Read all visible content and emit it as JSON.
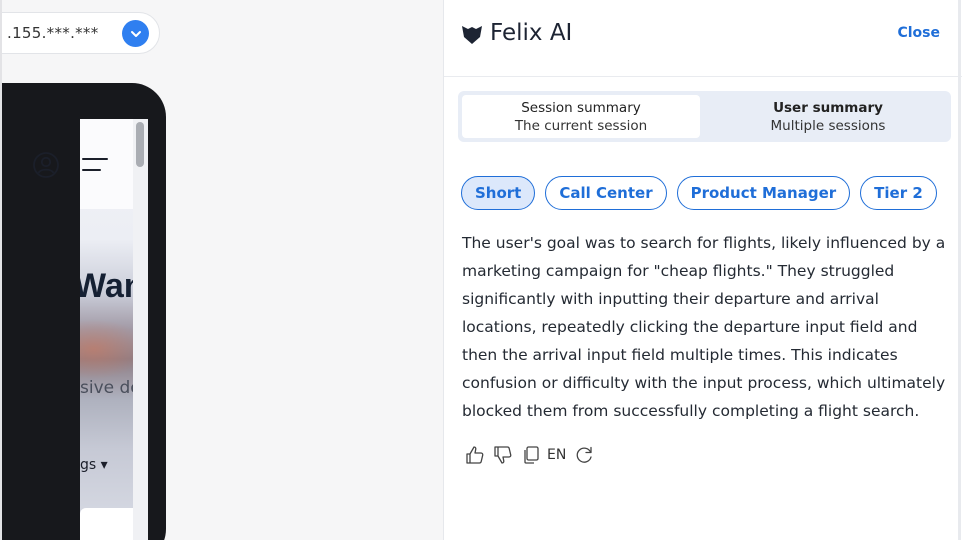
{
  "replay": {
    "ip_text": ".155.***.***",
    "ip_dropdown_icon": "chevron-down-icon",
    "headline": "Want To",
    "subtext": "sive deals",
    "dropdown_text": "gs ▾",
    "accent": "#2f7ff0"
  },
  "panel": {
    "title": "Felix AI",
    "logo_icon": "felix-logo-icon",
    "close_label": "Close",
    "tabs": [
      {
        "title": "Session summary",
        "subtitle": "The current session",
        "active": true
      },
      {
        "title": "User summary",
        "subtitle": "Multiple sessions",
        "active": false
      }
    ],
    "chips": [
      {
        "label": "Short",
        "active": true
      },
      {
        "label": "Call Center",
        "active": false
      },
      {
        "label": "Product Manager",
        "active": false
      },
      {
        "label": "Tier 2",
        "active": false
      }
    ],
    "summary_text": "The user's goal was to search for flights, likely influenced by a marketing campaign for \"cheap flights.\" They struggled significantly with inputting their departure and arrival locations, repeatedly clicking the departure input field and then the arrival input field multiple times. This indicates confusion or difficulty with the input process, which ultimately blocked them from successfully completing a flight search.",
    "actions": {
      "thumbs_up_icon": "thumbs-up-icon",
      "thumbs_down_icon": "thumbs-down-icon",
      "copy_icon": "copy-icon",
      "language": "EN",
      "refresh_icon": "refresh-icon"
    },
    "accent": "#1f6ed8"
  }
}
